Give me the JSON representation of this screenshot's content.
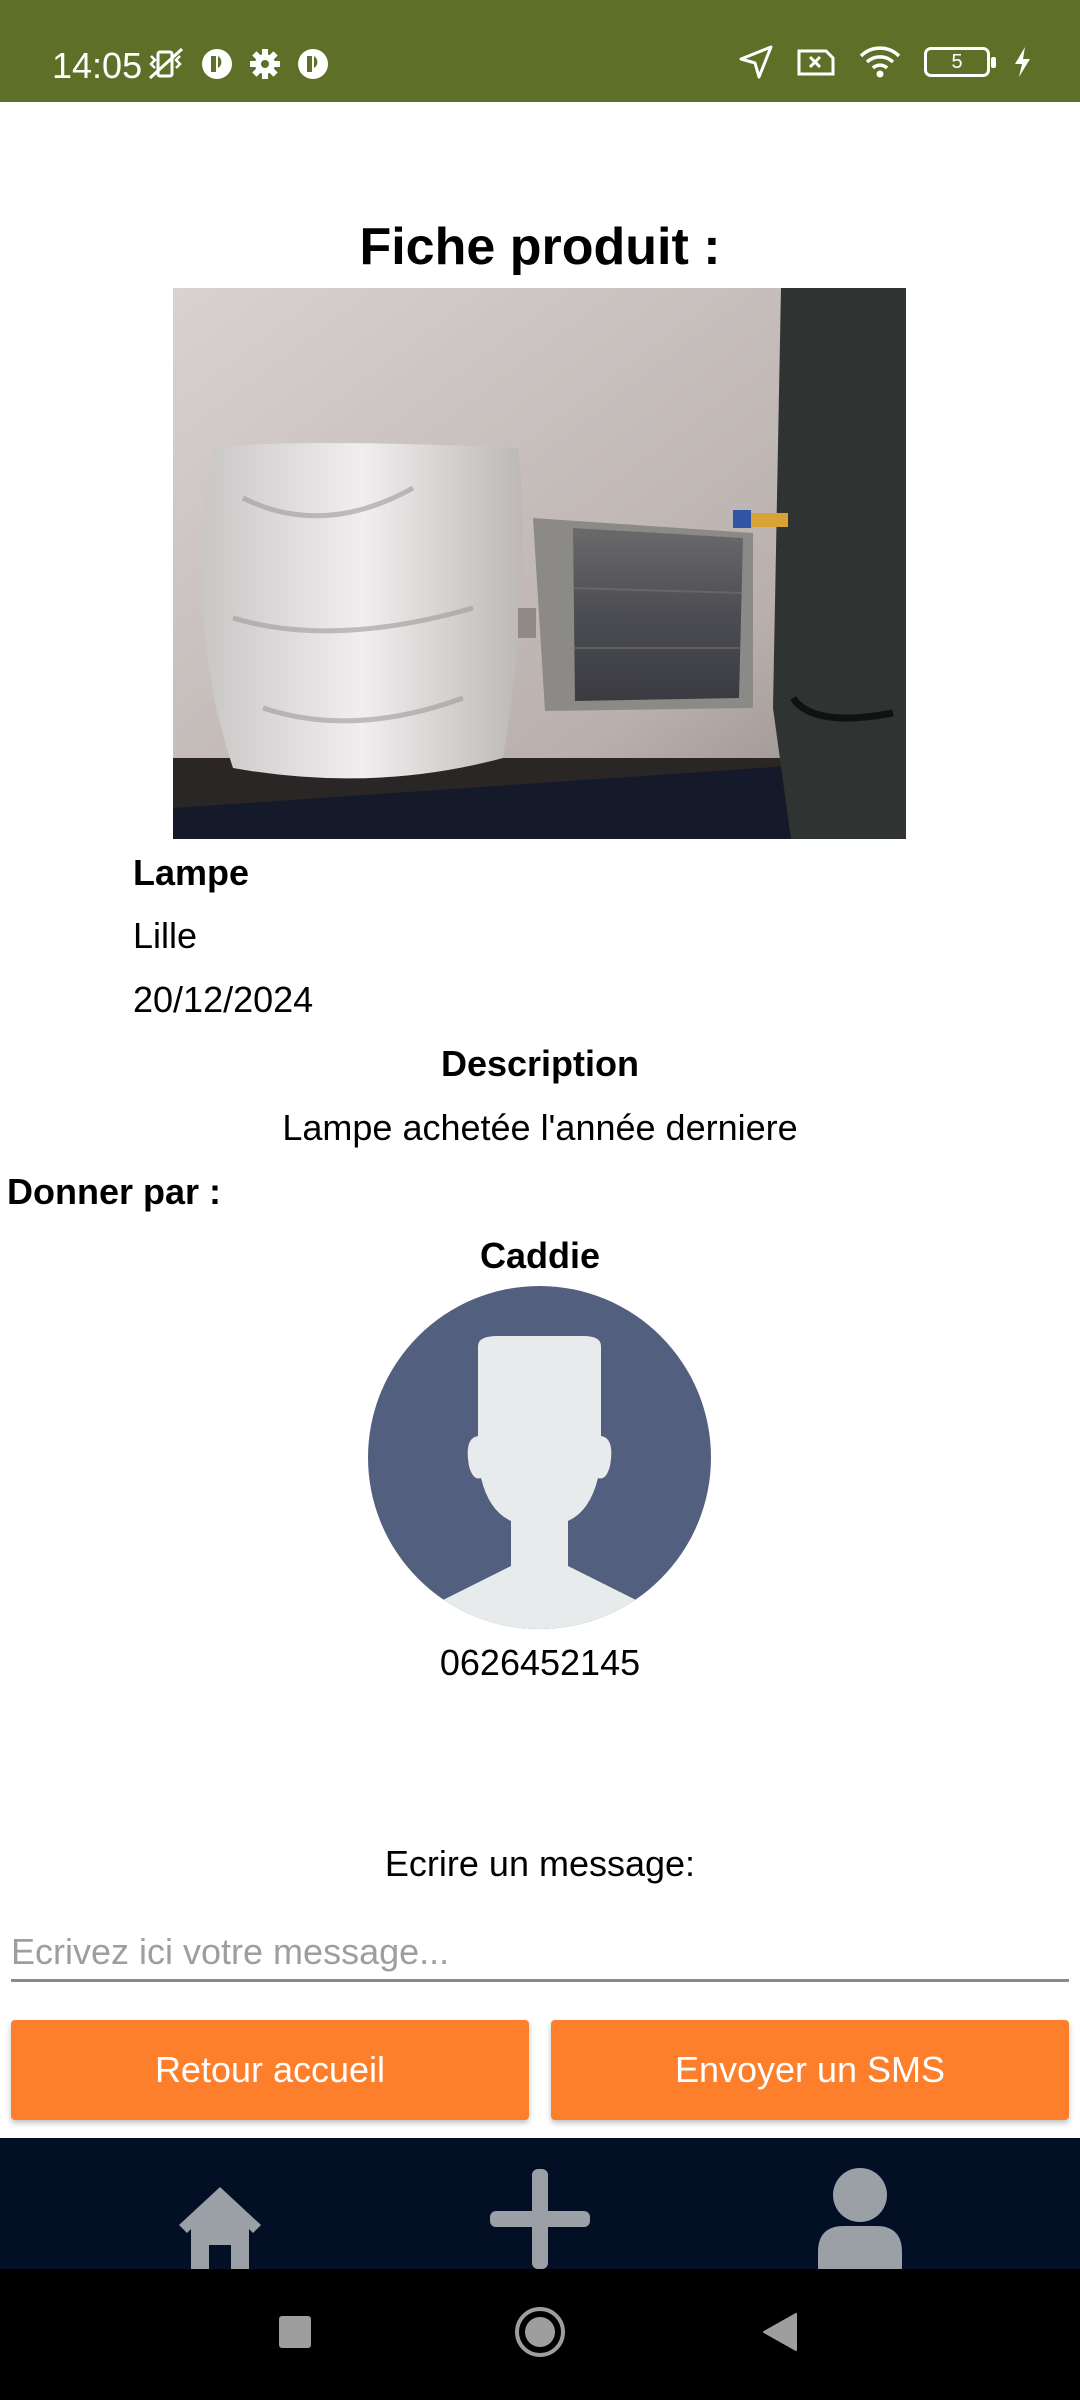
{
  "status_bar": {
    "time": "14:05",
    "battery_level": "5",
    "icons": [
      "vibrate-off-icon",
      "app-notification-icon",
      "settings-gear-icon",
      "app-notification-icon",
      "location-arrow-icon",
      "sim-x-icon",
      "wifi-icon",
      "battery-icon",
      "charging-bolt-icon"
    ]
  },
  "page": {
    "title": "Fiche produit :"
  },
  "product": {
    "image_icon": "lamp-photo",
    "name": "Lampe",
    "city": "Lille",
    "date": "20/12/2024",
    "description_title": "Description",
    "description": "Lampe achetée l'année derniere"
  },
  "donor": {
    "label": "Donner par :",
    "name": "Caddie",
    "avatar_icon": "default-user-avatar",
    "phone": "0626452145"
  },
  "message": {
    "label": "Ecrire un message:",
    "placeholder": "Ecrivez ici votre message...",
    "value": ""
  },
  "buttons": {
    "back": "Retour accueil",
    "sms": "Envoyer un SMS"
  },
  "colors": {
    "status_bar": "#5e7027",
    "button": "#fd7f2c",
    "tab_bar": "#030f24",
    "tab_icon": "#9aa0a6",
    "avatar_bg": "#535f7e",
    "avatar_fg": "#e7ebec"
  },
  "tab_bar": {
    "items": [
      "home-icon",
      "add-icon",
      "profile-icon"
    ]
  },
  "nav_bar": {
    "items": [
      "recents-square-icon",
      "home-circle-icon",
      "back-triangle-icon"
    ]
  }
}
